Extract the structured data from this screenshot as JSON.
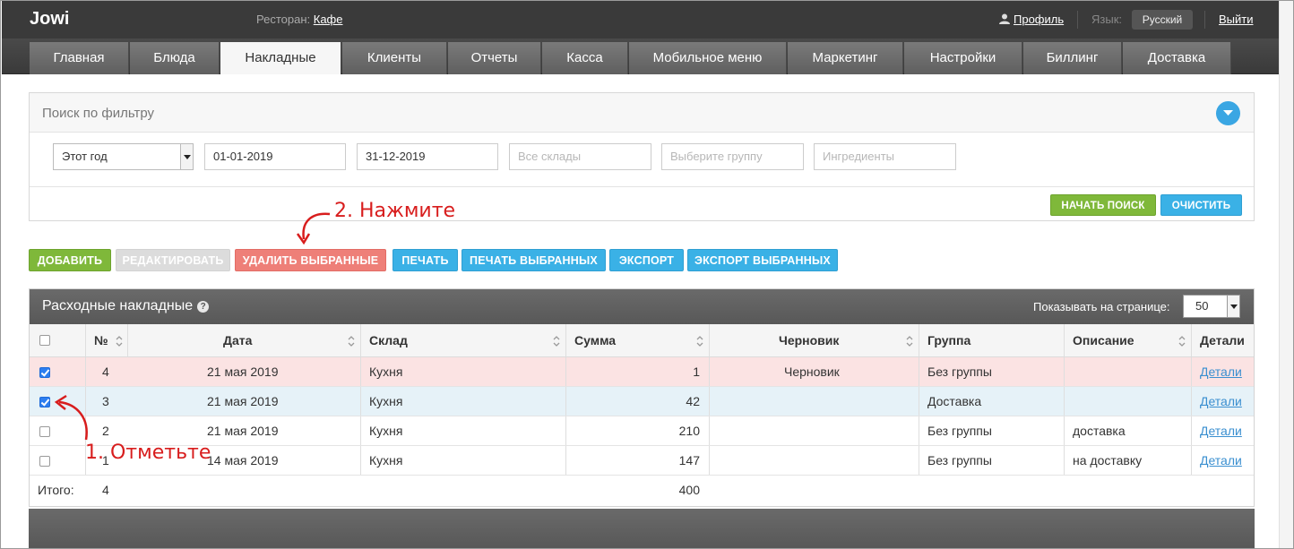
{
  "app": {
    "logo": "Jowi"
  },
  "topbar": {
    "restaurant_label": "Ресторан:",
    "restaurant_name": "Кафе",
    "profile": "Профиль",
    "language_label": "Язык:",
    "language_value": "Русский",
    "logout": "Выйти"
  },
  "nav": {
    "tabs": [
      "Главная",
      "Блюда",
      "Накладные",
      "Клиенты",
      "Отчеты",
      "Касса",
      "Мобильное меню",
      "Маркетинг",
      "Настройки",
      "Биллинг",
      "Доставка"
    ],
    "active": "Накладные"
  },
  "filter": {
    "title": "Поиск по фильтру",
    "period": "Этот год",
    "date_from": "01-01-2019",
    "date_to": "31-12-2019",
    "warehouse_placeholder": "Все склады",
    "group_placeholder": "Выберите группу",
    "ingredients_placeholder": "Ингредиенты",
    "search_button": "НАЧАТЬ ПОИСК",
    "clear_button": "ОЧИСТИТЬ"
  },
  "actions": {
    "add": "ДОБАВИТЬ",
    "edit": "РЕДАКТИРОВАТЬ",
    "delete_selected": "УДАЛИТЬ ВЫБРАННЫЕ",
    "print": "ПЕЧАТЬ",
    "print_selected": "ПЕЧАТЬ ВЫБРАННЫХ",
    "export": "ЭКСПОРТ",
    "export_selected": "ЭКСПОРТ ВЫБРАННЫХ"
  },
  "annotations": {
    "step1": "1. Отметьте",
    "step2": "2. Нажмите"
  },
  "table": {
    "title": "Расходные накладные",
    "per_page_label": "Показывать на странице:",
    "per_page_value": "50",
    "columns": [
      "№",
      "Дата",
      "Склад",
      "Сумма",
      "Черновик",
      "Группа",
      "Описание",
      "Детали"
    ],
    "rows": [
      {
        "checked": true,
        "num": "4",
        "date": "21 мая 2019",
        "warehouse": "Кухня",
        "sum": "1",
        "draft": "Черновик",
        "group": "Без группы",
        "description": "",
        "details": "Детали"
      },
      {
        "checked": true,
        "num": "3",
        "date": "21 мая 2019",
        "warehouse": "Кухня",
        "sum": "42",
        "draft": "",
        "group": "Доставка",
        "description": "",
        "details": "Детали"
      },
      {
        "checked": false,
        "num": "2",
        "date": "21 мая 2019",
        "warehouse": "Кухня",
        "sum": "210",
        "draft": "",
        "group": "Без группы",
        "description": "доставка",
        "details": "Детали"
      },
      {
        "checked": false,
        "num": "1",
        "date": "14 мая 2019",
        "warehouse": "Кухня",
        "sum": "147",
        "draft": "",
        "group": "Без группы",
        "description": "на доставку",
        "details": "Детали"
      }
    ],
    "total_label": "Итого:",
    "total_count": "4",
    "total_sum": "400"
  },
  "colors": {
    "green": "#7fb83a",
    "blue": "#3ab1e6",
    "red": "#ee7f78",
    "annotation": "#d81d1d",
    "selected_row": "#fbe3e3"
  }
}
